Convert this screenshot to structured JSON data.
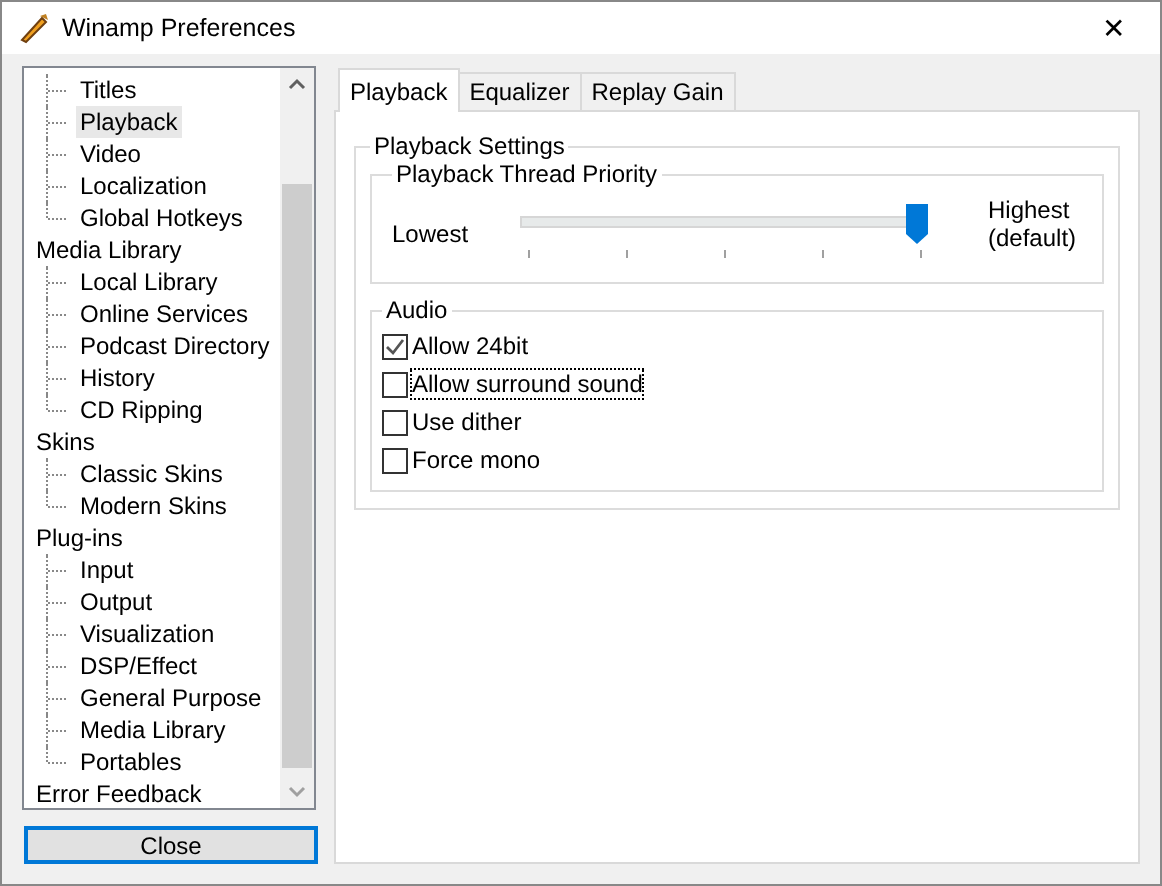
{
  "window": {
    "title": "Winamp Preferences",
    "close": "✕"
  },
  "tree": [
    {
      "children": [
        {
          "label": "Titles",
          "selected": false
        },
        {
          "label": "Playback",
          "selected": true
        },
        {
          "label": "Video",
          "selected": false
        },
        {
          "label": "Localization",
          "selected": false
        },
        {
          "label": "Global Hotkeys",
          "selected": false
        }
      ]
    },
    {
      "label": "Media Library",
      "selected": false,
      "children": [
        {
          "label": "Local Library",
          "selected": false
        },
        {
          "label": "Online Services",
          "selected": false
        },
        {
          "label": "Podcast Directory",
          "selected": false
        },
        {
          "label": "History",
          "selected": false
        },
        {
          "label": "CD Ripping",
          "selected": false
        }
      ]
    },
    {
      "label": "Skins",
      "selected": false,
      "children": [
        {
          "label": "Classic Skins",
          "selected": false
        },
        {
          "label": "Modern Skins",
          "selected": false
        }
      ]
    },
    {
      "label": "Plug-ins",
      "selected": false,
      "children": [
        {
          "label": "Input",
          "selected": false
        },
        {
          "label": "Output",
          "selected": false
        },
        {
          "label": "Visualization",
          "selected": false
        },
        {
          "label": "DSP/Effect",
          "selected": false
        },
        {
          "label": "General Purpose",
          "selected": false
        },
        {
          "label": "Media Library",
          "selected": false
        },
        {
          "label": "Portables",
          "selected": false
        }
      ]
    },
    {
      "label": "Error Feedback",
      "selected": false
    }
  ],
  "close_button": "Close",
  "tabs": [
    {
      "label": "Playback",
      "selected": true
    },
    {
      "label": "Equalizer",
      "selected": false
    },
    {
      "label": "Replay Gain",
      "selected": false
    }
  ],
  "settings": {
    "title": "Playback Settings",
    "priority": {
      "title": "Playback Thread Priority",
      "min_label": "Lowest",
      "max_label": "Highest",
      "max_note": "(default)",
      "level": 1
    },
    "audio": {
      "title": "Audio",
      "options": [
        {
          "label": "Allow 24bit",
          "checked": true,
          "focused": false
        },
        {
          "label": "Allow surround sound",
          "checked": false,
          "focused": true
        },
        {
          "label": "Use dither",
          "checked": false,
          "focused": false
        },
        {
          "label": "Force mono",
          "checked": false,
          "focused": false
        }
      ]
    }
  }
}
